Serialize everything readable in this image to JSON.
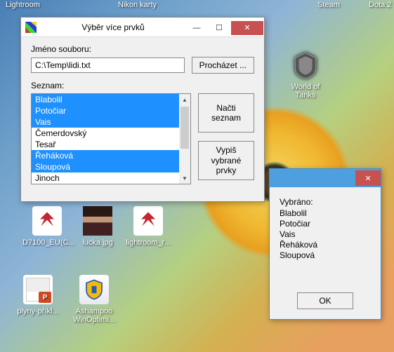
{
  "top_labels": {
    "left": "Lightroom",
    "mid": "Nikon karty",
    "right1": "Steam",
    "right2": "Dota 2"
  },
  "desktop_icons": {
    "wot": {
      "label": "World of\nTanks"
    },
    "pdf1": {
      "label": "D7100_EU(C..."
    },
    "img": {
      "label": "lucka.jpg"
    },
    "pdf2": {
      "label": "lightroom_r..."
    },
    "doc": {
      "label": "plyny-příkl..."
    },
    "ash": {
      "label": "Ashampoo\nWinOptimi..."
    }
  },
  "main": {
    "title": "Výběr více prvků",
    "file_label": "Jméno souboru:",
    "file_value": "C:\\Temp\\lidi.txt",
    "browse": "Procházet ...",
    "list_label": "Seznam:",
    "items": [
      {
        "text": "Blabolil",
        "selected": true
      },
      {
        "text": "Potočiar",
        "selected": true
      },
      {
        "text": "Vais",
        "selected": true
      },
      {
        "text": "Čemerdovský",
        "selected": false
      },
      {
        "text": "Tesař",
        "selected": false
      },
      {
        "text": "Řeháková",
        "selected": true
      },
      {
        "text": "Sloupová",
        "selected": true
      },
      {
        "text": "Jinoch",
        "selected": false
      }
    ],
    "btn_load": "Načti seznam",
    "btn_show": "Vypiš vybrané prvky"
  },
  "sub": {
    "heading": "Vybráno:",
    "items": [
      "Blabolil",
      "Potočiar",
      "Vais",
      "Řeháková",
      "Sloupová"
    ],
    "ok": "OK"
  },
  "win": {
    "min": "—",
    "max": "☐",
    "close": "✕"
  }
}
